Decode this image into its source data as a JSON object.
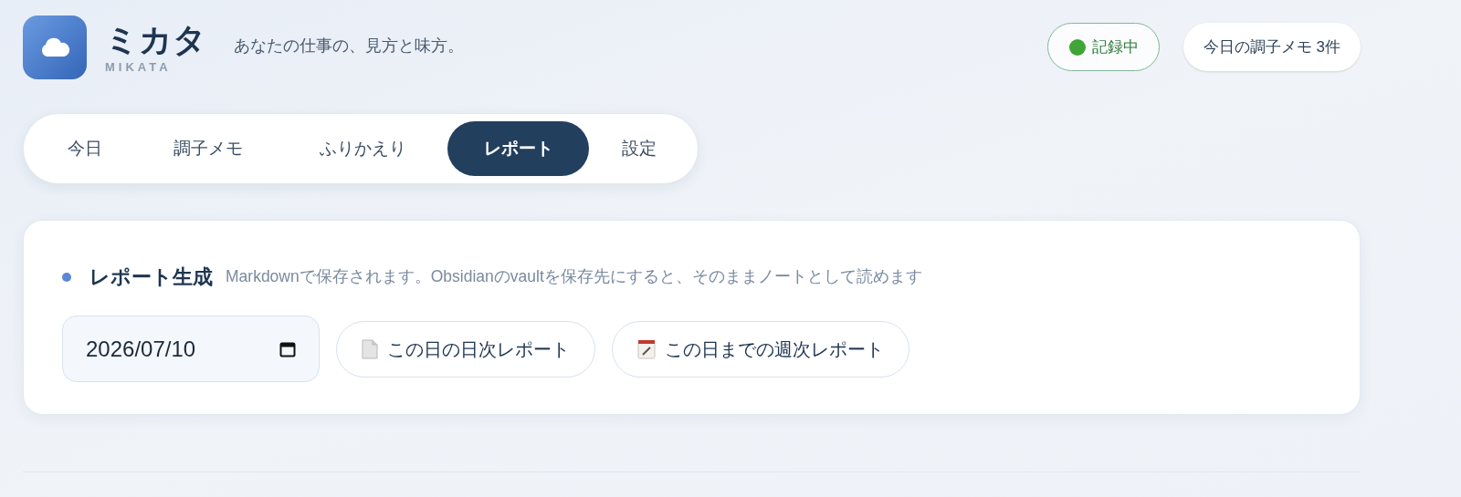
{
  "app": {
    "name": "ミカタ",
    "name_latin": "MIKATA",
    "tagline": "あなたの仕事の、見方と味方。"
  },
  "header_badges": [
    {
      "kind": "status",
      "label": "記録中"
    },
    {
      "kind": "count",
      "label": "今日の調子メモ 3件"
    }
  ],
  "tabs": [
    {
      "label": "今日",
      "selected": false
    },
    {
      "label": "調子メモ",
      "selected": false
    },
    {
      "label": "ふりかえり",
      "selected": false
    },
    {
      "label": "レポート",
      "selected": true
    },
    {
      "label": "設定",
      "selected": false
    }
  ],
  "report_card": {
    "title": "レポート生成",
    "description": "Markdownで保存されます。Obsidianのvaultを保存先にすると、そのままノートとして読めます",
    "date": {
      "value": "2026/07/10"
    },
    "buttons": [
      {
        "kind": "daily",
        "label": "この日の日次レポート"
      },
      {
        "kind": "weekly",
        "label": "この日までの週次レポート"
      }
    ]
  }
}
